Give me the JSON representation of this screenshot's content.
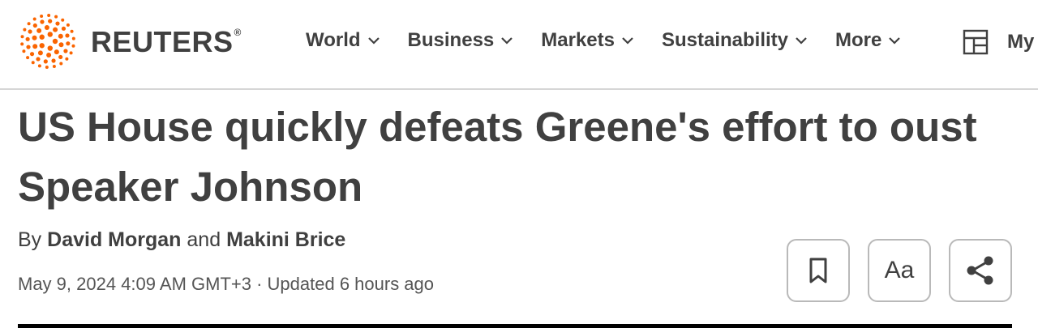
{
  "brand": {
    "name": "REUTERS",
    "registered": "®",
    "accent_color": "#fa6400"
  },
  "nav": {
    "items": [
      {
        "label": "World"
      },
      {
        "label": "Business"
      },
      {
        "label": "Markets"
      },
      {
        "label": "Sustainability"
      },
      {
        "label": "More"
      }
    ],
    "mynews_label": "My"
  },
  "article": {
    "headline": "US House quickly defeats Greene's effort to oust Speaker Johnson",
    "byline": {
      "prefix": "By",
      "author1": "David Morgan",
      "conjunction": "and",
      "author2": "Makini Brice"
    },
    "dateline": "May 9, 2024 4:09 AM GMT+3 · Updated 6 hours ago"
  },
  "actions": {
    "font_size_label": "Aa",
    "icons": [
      "bookmark-icon",
      "font-size-icon",
      "share-icon"
    ]
  }
}
